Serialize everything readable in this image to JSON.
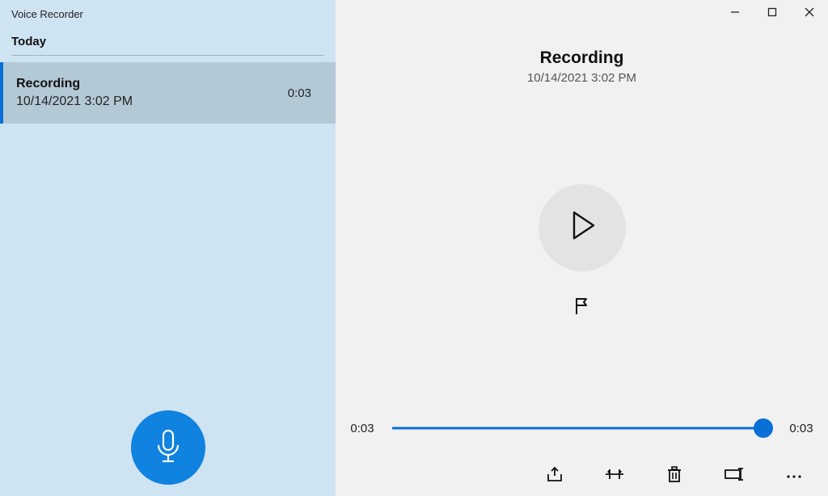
{
  "app": {
    "title": "Voice Recorder"
  },
  "sidebar": {
    "section_header": "Today",
    "items": [
      {
        "title": "Recording",
        "date": "10/14/2021 3:02 PM",
        "duration": "0:03"
      }
    ]
  },
  "main": {
    "title": "Recording",
    "date": "10/14/2021 3:02 PM",
    "playback": {
      "elapsed": "0:03",
      "total": "0:03"
    }
  },
  "colors": {
    "accent": "#0a6fd6"
  }
}
